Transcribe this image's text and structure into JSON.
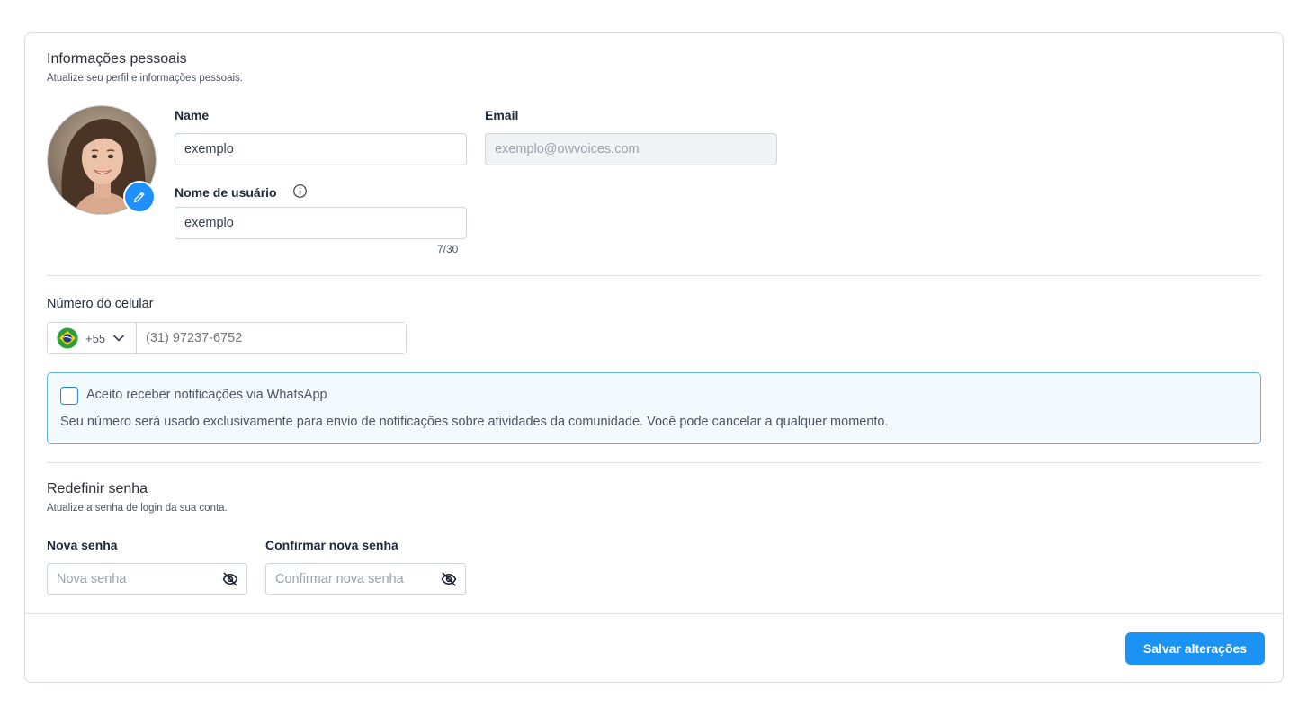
{
  "personal": {
    "title": "Informações pessoais",
    "subtitle": "Atualize seu perfil e informações pessoais.",
    "name_label": "Name",
    "name_value": "exemplo",
    "email_label": "Email",
    "email_placeholder": "exemplo@owvoices.com",
    "username_label": "Nome de usuário",
    "username_value": "exemplo",
    "username_counter": "7/30"
  },
  "phone": {
    "label": "Número do celular",
    "country_code": "+55",
    "flag_icon": "brazil-flag-icon",
    "placeholder": "(31) 97237-6752"
  },
  "whatsapp": {
    "checkbox_label": "Aceito receber notificações via WhatsApp",
    "checked": false,
    "description": "Seu número será usado exclusivamente para envio de notificações sobre atividades da comunidade. Você pode cancelar a qualquer momento."
  },
  "password": {
    "title": "Redefinir senha",
    "subtitle": "Atualize a senha de login da sua conta.",
    "new_label": "Nova senha",
    "new_placeholder": "Nova senha",
    "confirm_label": "Confirmar nova senha",
    "confirm_placeholder": "Confirmar nova senha"
  },
  "actions": {
    "save_label": "Salvar alterações"
  },
  "colors": {
    "accent": "#1a93f5",
    "notice_border": "#5fb6ea",
    "notice_bg": "#f3fafe"
  }
}
